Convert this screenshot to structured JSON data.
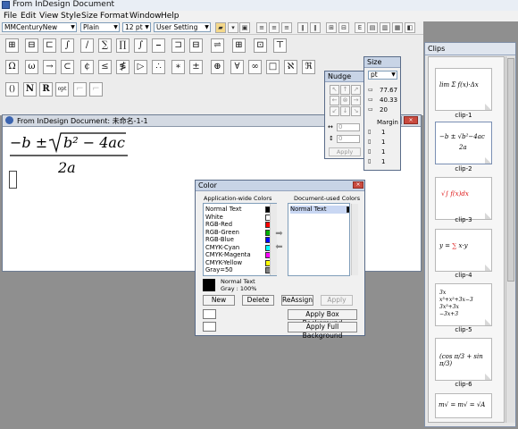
{
  "app": {
    "title": "From InDesign Document"
  },
  "menu": [
    "File",
    "Edit",
    "View",
    "Style",
    "Size",
    "Format",
    "Window",
    "Help"
  ],
  "toolbar": {
    "font": "MMCenturyNew",
    "style": "Plain",
    "size": "12 pt",
    "setting": "User Setting"
  },
  "palette_row1": [
    "⊞",
    "⊟",
    "⊏",
    "∫",
    "/",
    "∑",
    "∏",
    "∫",
    "⎯",
    "⊐",
    "⊟",
    "⇌",
    "⊞",
    "⊡",
    "⊤"
  ],
  "palette_row2": [
    "Ω",
    "ω",
    "→",
    "⊂",
    "¢",
    "≤",
    "≸",
    "▷",
    "∴",
    "∗",
    "±",
    "⊕",
    "∀",
    "∞",
    "□",
    "ℵ",
    "ℜ"
  ],
  "palette_row3": [
    "()",
    "N",
    "R",
    "opt"
  ],
  "document": {
    "title": "From InDesign Document: 未命名-1-1",
    "numerator_prefix": "−b ±",
    "radicand": "b² − 4ac",
    "denominator": "2a"
  },
  "nudge": {
    "title": "Nudge",
    "x_value": "0",
    "y_value": "0",
    "apply": "Apply"
  },
  "size_panel": {
    "title": "Size",
    "unit": "pt",
    "width": "77.67",
    "height": "40.33",
    "depth": "20",
    "margin_label": "Margin",
    "margins": [
      "1",
      "1",
      "1",
      "1"
    ]
  },
  "color_panel": {
    "title": "Color",
    "app_colors_label": "Application-wide Colors",
    "doc_colors_label": "Document-used Colors",
    "app_colors": [
      {
        "name": "Normal Text",
        "color": "#000000"
      },
      {
        "name": "White",
        "color": "#ffffff"
      },
      {
        "name": "RGB-Red",
        "color": "#ff0000"
      },
      {
        "name": "RGB-Green",
        "color": "#00b000"
      },
      {
        "name": "RGB-Blue",
        "color": "#0000ff"
      },
      {
        "name": "CMYK-Cyan",
        "color": "#00ffff"
      },
      {
        "name": "CMYK-Magenta",
        "color": "#ff00ff"
      },
      {
        "name": "CMYK-Yellow",
        "color": "#ffff00"
      },
      {
        "name": "Gray=50",
        "color": "#808080"
      }
    ],
    "doc_colors": [
      {
        "name": "Normal Text",
        "color": "#000000"
      }
    ],
    "selected_name": "Normal Text",
    "selected_detail": "Gray : 100%",
    "new": "New",
    "delete": "Delete",
    "reassign": "ReAssign",
    "apply": "Apply",
    "apply_box_bg": "Apply Box Background",
    "apply_full_bg": "Apply Full Background"
  },
  "clips": {
    "title": "Clips",
    "items": [
      "clip-1",
      "clip-2",
      "clip-3",
      "clip-4",
      "clip-5",
      "clip-6"
    ],
    "selected_index": 1
  }
}
